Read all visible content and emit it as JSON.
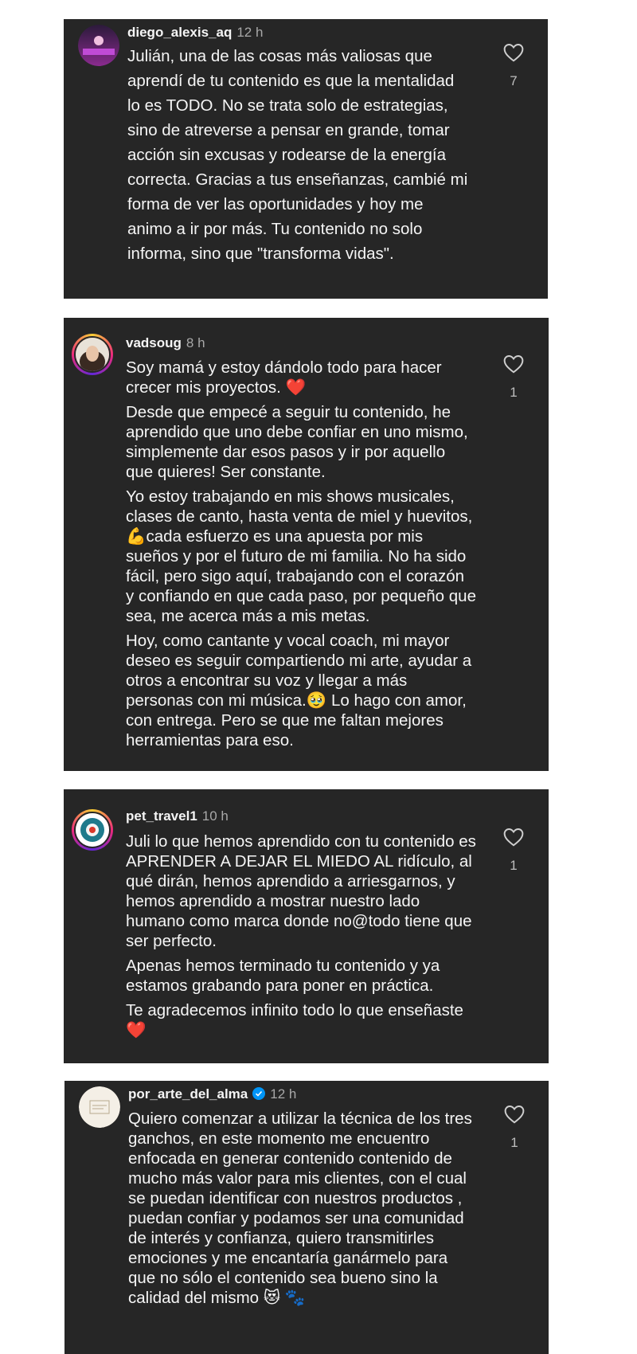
{
  "comments": [
    {
      "username": "diego_alexis_aq",
      "time": "12 h",
      "paragraphs": [
        "Julián, una de las cosas más valiosas que aprendí de tu contenido es que la mentalidad lo es TODO. No se trata solo de estrategias, sino de atreverse a pensar en grande, tomar acción sin excusas y rodearse de la energía correcta. Gracias a tus enseñanzas, cambié mi forma de ver las oportunidades y hoy me animo a ir por más. Tu contenido no solo informa, sino que \"transforma vidas\"."
      ],
      "likes": "7"
    },
    {
      "username": "vadsoug",
      "time": "8 h",
      "paragraphs": [
        "Soy mamá y estoy dándolo todo para hacer crecer mis proyectos. ❤️",
        "Desde que empecé a seguir tu contenido, he aprendido que uno debe confiar en uno mismo, simplemente dar esos pasos y ir por aquello que quieres! Ser constante.",
        "Yo estoy trabajando en mis shows musicales, clases de canto, hasta  venta de miel y huevitos, 💪cada esfuerzo es una apuesta por mis sueños y por el futuro de mi familia. No ha sido fácil, pero sigo aquí, trabajando con el corazón y confiando en que cada paso, por pequeño que sea, me acerca más a mis metas.",
        "Hoy, como cantante y vocal coach, mi mayor deseo es seguir compartiendo mi arte, ayudar a otros a encontrar su voz y llegar a más personas con mi música.🥹 Lo hago con amor, con entrega. Pero se que me faltan mejores herramientas para eso."
      ],
      "likes": "1"
    },
    {
      "username": "pet_travel1",
      "time": "10 h",
      "paragraphs": [
        "Juli lo que hemos aprendido con tu contenido es APRENDER A DEJAR EL MIEDO AL ridículo, al qué dirán, hemos aprendido a arriesgarnos, y hemos aprendido a mostrar nuestro lado humano como marca donde no@todo tiene que ser perfecto.",
        "Apenas hemos terminado tu contenido y ya estamos grabando para poner en práctica.",
        "Te agradecemos infinito todo lo que enseñaste ❤️"
      ],
      "likes": "1"
    },
    {
      "username": "por_arte_del_alma",
      "time": "12 h",
      "paragraphs": [
        "Quiero comenzar a utilizar la técnica de los tres ganchos, en este momento me encuentro enfocada en generar contenido contenido de mucho más valor para mis clientes, con el cual se puedan identificar con nuestros productos , puedan confiar y podamos ser una comunidad de interés y confianza, quiero transmitirles emociones y me encantaría ganármelo para que no sólo el contenido sea bueno sino la calidad del mismo 😻 🐾"
      ],
      "likes": "1"
    }
  ],
  "colors": {
    "card_bg": "#262626",
    "text": "#f5f5f5",
    "muted": "#a8a8a8",
    "verified": "#0095f6"
  }
}
